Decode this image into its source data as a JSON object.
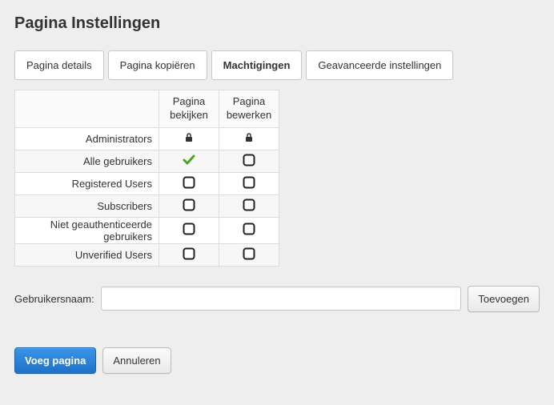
{
  "page_title": "Pagina Instellingen",
  "tabs": [
    {
      "label": "Pagina details",
      "active": false
    },
    {
      "label": "Pagina kopiëren",
      "active": false
    },
    {
      "label": "Machtigingen",
      "active": true
    },
    {
      "label": "Geavanceerde instellingen",
      "active": false
    }
  ],
  "permissions_table": {
    "columns": [
      {
        "header": "Pagina bekijken"
      },
      {
        "header": "Pagina bewerken"
      }
    ],
    "rows": [
      {
        "role": "Administrators",
        "view": "locked",
        "edit": "locked"
      },
      {
        "role": "Alle gebruikers",
        "view": "checked",
        "edit": "unchecked"
      },
      {
        "role": "Registered Users",
        "view": "unchecked",
        "edit": "unchecked"
      },
      {
        "role": "Subscribers",
        "view": "unchecked",
        "edit": "unchecked"
      },
      {
        "role": "Niet geauthenticeerde gebruikers",
        "view": "unchecked",
        "edit": "unchecked"
      },
      {
        "role": "Unverified Users",
        "view": "unchecked",
        "edit": "unchecked"
      }
    ]
  },
  "username_form": {
    "label": "Gebruikersnaam:",
    "value": "",
    "add_button_label": "Toevoegen"
  },
  "actions": {
    "primary_label": "Voeg pagina",
    "cancel_label": "Annuleren"
  },
  "icons": {
    "locked": "lock-icon",
    "checked": "check-icon",
    "unchecked": "checkbox-empty-icon"
  },
  "colors": {
    "check_green": "#4aa321",
    "primary_blue": "#2a81d7"
  }
}
